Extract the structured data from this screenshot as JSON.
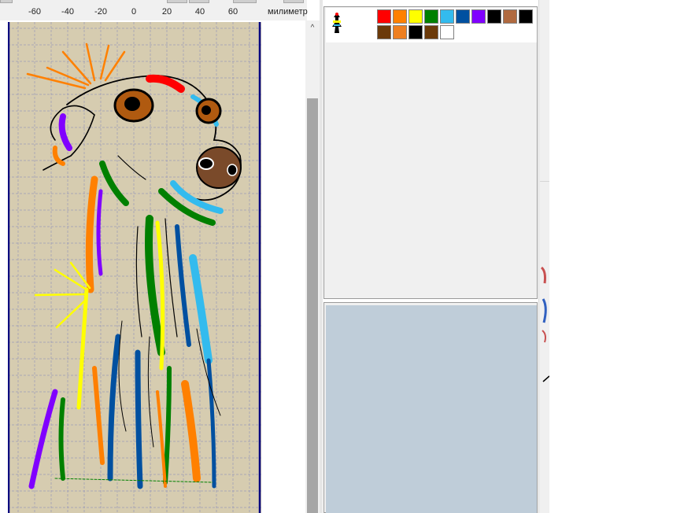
{
  "ruler": {
    "unit_label": "милиметр",
    "ticks": [
      "-60",
      "-40",
      "-20",
      "0",
      "20",
      "40",
      "60"
    ]
  },
  "scrollbar": {
    "up_arrow": "^"
  },
  "palette": {
    "thread_icon": "thread-spool-icon",
    "swatches": [
      "#ff0000",
      "#ff8000",
      "#ffff00",
      "#008000",
      "#33bbee",
      "#0050a0",
      "#8000ff",
      "#000000",
      "#b06a40",
      "#000000",
      "#6b3a0a",
      "#ee7f20",
      "#000000",
      "#6b3a0a",
      "#ffffff"
    ]
  },
  "colors": {
    "hoop_fill": "#d6ccb0",
    "hoop_border": "#000080",
    "grid_line": "#9a9ab8",
    "preview_fill": "#bfcdd9"
  }
}
